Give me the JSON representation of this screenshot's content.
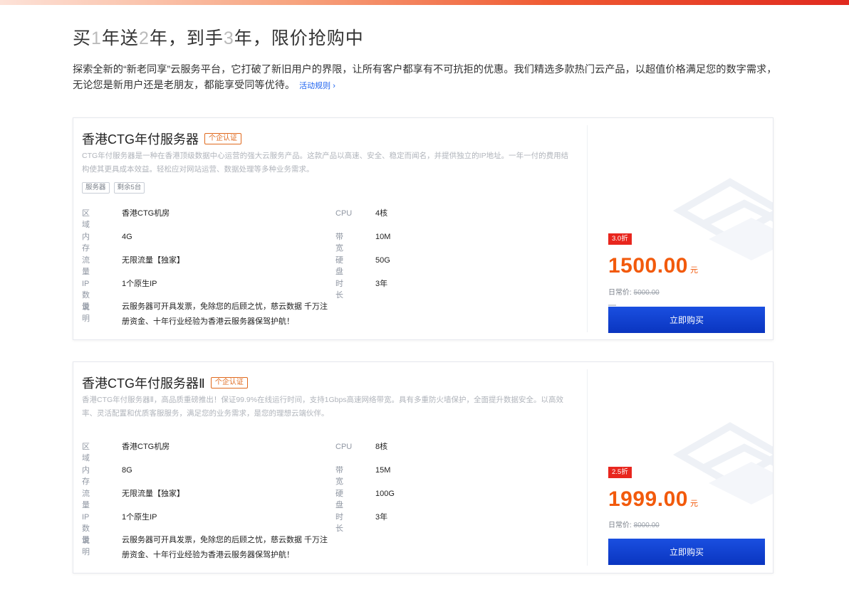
{
  "header": {
    "title_parts": [
      "买",
      "1",
      "年送",
      "2",
      "年，到手",
      "3",
      "年，限价抢购中"
    ],
    "intro": "探索全新的“新老同享”云服务平台，它打破了新旧用户的界限，让所有客户都享有不可抗拒的优惠。我们精选多款热门云产品，以超值价格满足您的数字需求，无论您是新用户还是老朋友，都能享受同等优待。",
    "rules_link": "活动规则",
    "rules_chevron": "›"
  },
  "products": [
    {
      "name": "香港CTG年付服务器",
      "auth_badge": "个企认证",
      "description": "CTG年付服务器是一种在香港顶级数据中心运营的强大云服务产品。这款产品以高速、安全、稳定而闻名，并提供独立的IP地址。一年一付的费用结构使其更具成本效益。轻松应对网站运营、数据处理等多种业务需求。",
      "tags": [
        "服务器",
        "剩余5台"
      ],
      "specs": {
        "region": {
          "label": "区域",
          "value": "香港CTG机房"
        },
        "cpu": {
          "label": "CPU",
          "value": "4核"
        },
        "memory": {
          "label": "内存",
          "value": "4G"
        },
        "bandwidth": {
          "label": "带宽",
          "value": "10M"
        },
        "traffic": {
          "label": "流量",
          "value": "无限流量【独家】"
        },
        "disk": {
          "label": "硬盘",
          "value": "50G"
        },
        "ip": {
          "label": "IP数量",
          "value": "1个原生IP"
        },
        "duration": {
          "label": "时长",
          "value": "3年"
        },
        "note": {
          "label": "说明",
          "value": "云服务器可开具发票，免除您的后顾之忧，慈云数据 千万注册资金、十年行业经验为香港云服务器保驾护航！"
        }
      },
      "discount": "3.0折",
      "price": "1500.00",
      "currency": "元",
      "original_label": "日常价:",
      "original_price": "5000.00",
      "buy_label": "立即购买"
    },
    {
      "name": "香港CTG年付服务器Ⅱ",
      "auth_badge": "个企认证",
      "description": "香港CTG年付服务器Ⅱ，高品质重磅推出！保证99.9%在线运行时间，支持1Gbps高速网络带宽。具有多重防火墙保护，全面提升数据安全。以高效率、灵活配置和优质客服服务，满足您的业务需求，是您的理想云端伙伴。",
      "tags": [],
      "specs": {
        "region": {
          "label": "区域",
          "value": "香港CTG机房"
        },
        "cpu": {
          "label": "CPU",
          "value": "8核"
        },
        "memory": {
          "label": "内存",
          "value": "8G"
        },
        "bandwidth": {
          "label": "带宽",
          "value": "15M"
        },
        "traffic": {
          "label": "流量",
          "value": "无限流量【独家】"
        },
        "disk": {
          "label": "硬盘",
          "value": "100G"
        },
        "ip": {
          "label": "IP数量",
          "value": "1个原生IP"
        },
        "duration": {
          "label": "时长",
          "value": "3年"
        },
        "note": {
          "label": "说明",
          "value": "云服务器可开具发票，免除您的后顾之忧，慈云数据 千万注册资金、十年行业经验为香港云服务器保驾护航！"
        }
      },
      "discount": "2.5折",
      "price": "1999.00",
      "currency": "元",
      "original_label": "日常价:",
      "original_price": "8000.00",
      "buy_label": "立即购买"
    }
  ],
  "colors": {
    "accent_orange": "#f25a0c",
    "discount_red": "#e8261e",
    "button_blue": "#0a35c0",
    "link_blue": "#1d62f0"
  }
}
